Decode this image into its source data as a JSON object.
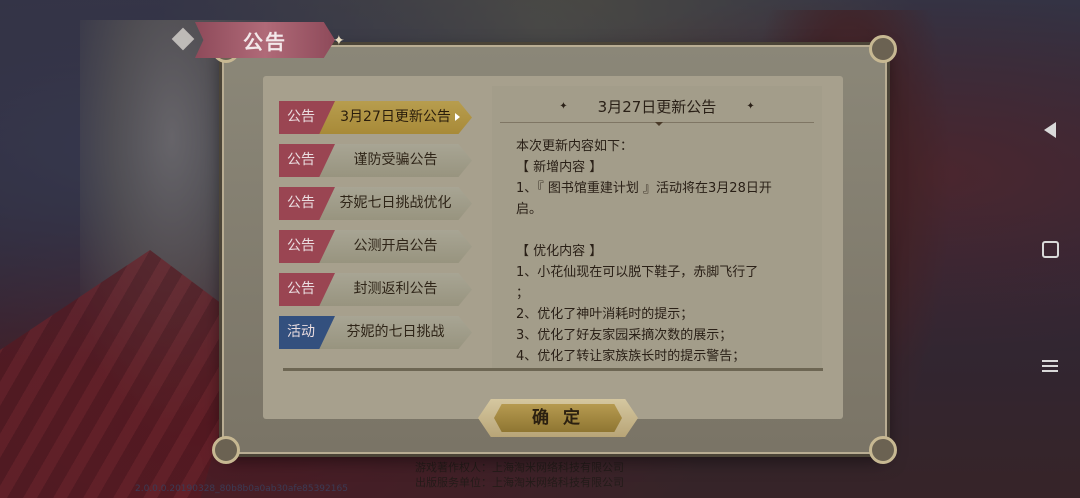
{
  "dialog": {
    "title": "公告",
    "confirm_label": "确 定"
  },
  "tabs": [
    {
      "badge": "公告",
      "label": "3月27日更新公告",
      "active": true,
      "badge_color": "#9a4552"
    },
    {
      "badge": "公告",
      "label": "谨防受骗公告",
      "active": false,
      "badge_color": "#9a4552"
    },
    {
      "badge": "公告",
      "label": "芬妮七日挑战优化",
      "active": false,
      "badge_color": "#9a4552"
    },
    {
      "badge": "公告",
      "label": "公测开启公告",
      "active": false,
      "badge_color": "#9a4552"
    },
    {
      "badge": "公告",
      "label": "封测返利公告",
      "active": false,
      "badge_color": "#9a4552"
    },
    {
      "badge": "活动",
      "label": "芬妮的七日挑战",
      "active": false,
      "badge_color": "#33507e"
    }
  ],
  "content": {
    "header": "3月27日更新公告",
    "lines": [
      "本次更新内容如下：",
      "【 新增内容 】",
      "1、『 图书馆重建计划 』活动将在3月28日开",
      "启。",
      "",
      "【 优化内容 】",
      "1、小花仙现在可以脱下鞋子，赤脚飞行了",
      "；",
      "2、优化了神叶消耗时的提示；",
      "3、优化了好友家园采摘次数的展示；",
      "4、优化了转让家族族长时的提示警告；"
    ]
  },
  "footer": {
    "credit1": "游戏著作权人：上海淘米网络科技有限公司",
    "credit2": "出版服务单位：上海淘米网络科技有限公司",
    "build": "2.0.0.0.20190328_80b8b0a0ab30afe85392165"
  },
  "colors": {
    "accent_gold": "#b79d4e",
    "badge_red": "#9a4552",
    "badge_blue": "#33507e",
    "title_pink": "#b06a78"
  }
}
